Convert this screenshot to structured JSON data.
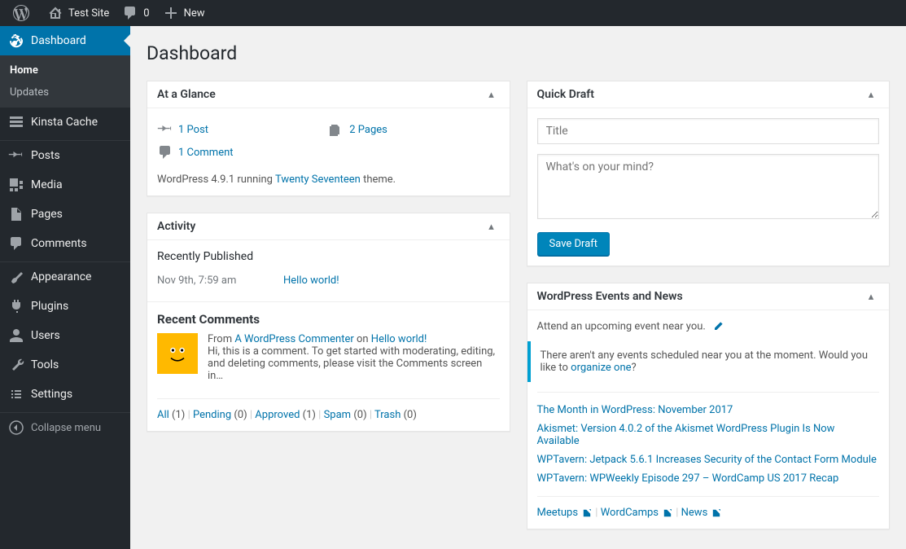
{
  "adminbar": {
    "site_name": "Test Site",
    "comments_count": "0",
    "new_label": "New"
  },
  "sidebar": {
    "dashboard": "Dashboard",
    "home": "Home",
    "updates": "Updates",
    "kinsta_cache": "Kinsta Cache",
    "posts": "Posts",
    "media": "Media",
    "pages": "Pages",
    "comments": "Comments",
    "appearance": "Appearance",
    "plugins": "Plugins",
    "users": "Users",
    "tools": "Tools",
    "settings": "Settings",
    "collapse": "Collapse menu"
  },
  "page_title": "Dashboard",
  "glance": {
    "title": "At a Glance",
    "post": "1 Post",
    "pages": "2 Pages",
    "comment": "1 Comment",
    "wp_prefix": "WordPress 4.9.1 running ",
    "theme": "Twenty Seventeen",
    "wp_suffix": " theme."
  },
  "activity": {
    "title": "Activity",
    "published_heading": "Recently Published",
    "published_time": "Nov 9th, 7:59 am",
    "published_link": "Hello world!",
    "comments_heading": "Recent Comments",
    "comment_from": "From ",
    "comment_author": "A WordPress Commenter",
    "comment_on": " on ",
    "comment_post": "Hello world!",
    "comment_text": "Hi, this is a comment. To get started with moderating, editing, and deleting comments, please visit the Comments screen in…",
    "filters": {
      "all": "All",
      "all_count": "(1)",
      "pending": "Pending",
      "pending_count": "(0)",
      "approved": "Approved",
      "approved_count": "(1)",
      "spam": "Spam",
      "spam_count": "(0)",
      "trash": "Trash",
      "trash_count": "(0)"
    }
  },
  "quickdraft": {
    "title": "Quick Draft",
    "title_placeholder": "Title",
    "content_placeholder": "What's on your mind?",
    "save_button": "Save Draft"
  },
  "events": {
    "title": "WordPress Events and News",
    "intro": "Attend an upcoming event near you.",
    "none_text": "There aren't any events scheduled near you at the moment. Would you like to ",
    "organize_link": "organize one",
    "news": [
      "The Month in WordPress: November 2017",
      "Akismet: Version 4.0.2 of the Akismet WordPress Plugin Is Now Available",
      "WPTavern: Jetpack 5.6.1 Increases Security of the Contact Form Module",
      "WPTavern: WPWeekly Episode 297 – WordCamp US 2017 Recap"
    ],
    "footer": {
      "meetups": "Meetups",
      "wordcamps": "WordCamps",
      "news_link": "News"
    }
  }
}
